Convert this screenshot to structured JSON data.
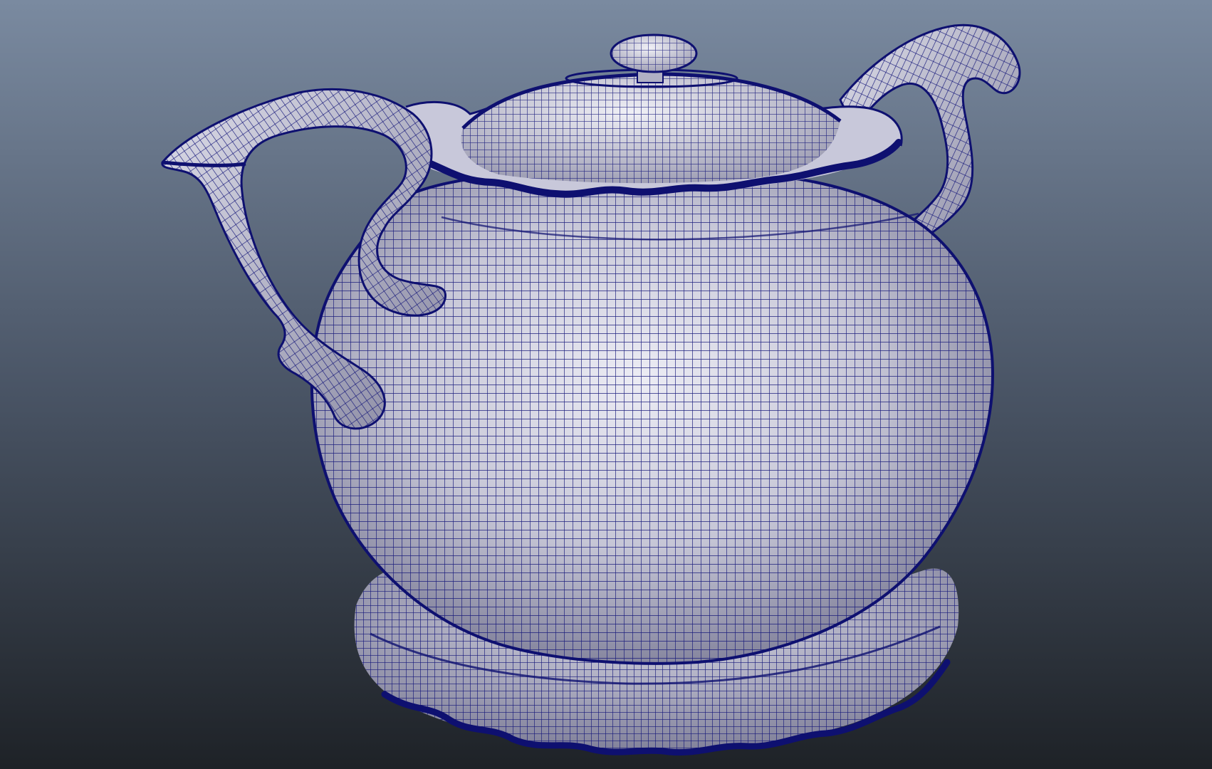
{
  "viewport": {
    "background_top": "#7a8aa0",
    "background_mid": "#4a5566",
    "background_bottom": "#1e2227",
    "model_name": "teapot",
    "display_mode": "wireframe-on-shaded"
  },
  "model": {
    "surface_light": "#e4e4ee",
    "surface_mid": "#b4b4c8",
    "surface_dark": "#6e6e88",
    "wire_color": "#16187a",
    "rim_color": "#0e1070"
  }
}
